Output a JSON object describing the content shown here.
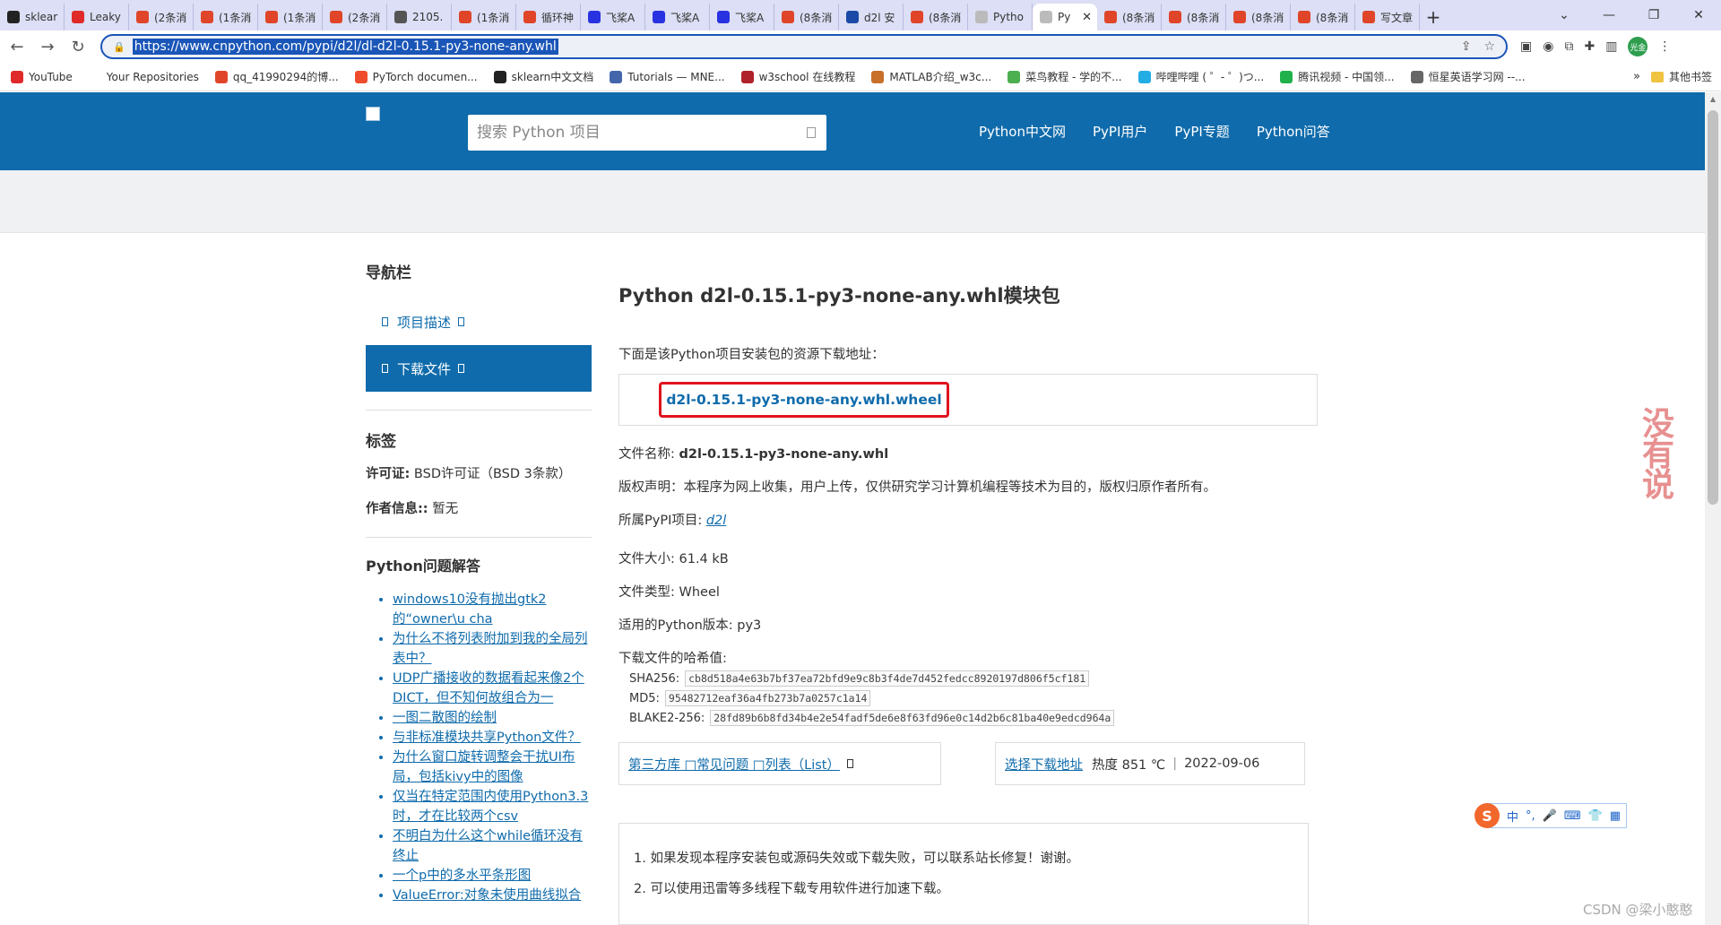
{
  "browser": {
    "tabs": [
      {
        "label": "sklear",
        "color": "#222"
      },
      {
        "label": "Leaky",
        "color": "#e02a2a"
      },
      {
        "label": "(2条消",
        "color": "#e0452a"
      },
      {
        "label": "(1条消",
        "color": "#e0452a"
      },
      {
        "label": "(1条消",
        "color": "#e0452a"
      },
      {
        "label": "(2条消",
        "color": "#e0452a"
      },
      {
        "label": "2105.",
        "color": "#555"
      },
      {
        "label": "(1条消",
        "color": "#e0452a"
      },
      {
        "label": "循环神",
        "color": "#e0452a"
      },
      {
        "label": "飞桨A",
        "color": "#2932e1"
      },
      {
        "label": "飞桨A",
        "color": "#2932e1"
      },
      {
        "label": "飞桨A",
        "color": "#2932e1"
      },
      {
        "label": "(8条消",
        "color": "#e0452a"
      },
      {
        "label": "d2l 安",
        "color": "#1a4aa8"
      },
      {
        "label": "(8条消",
        "color": "#e0452a"
      },
      {
        "label": "Pytho",
        "color": "#bbb"
      },
      {
        "label": "Py",
        "color": "#bbb",
        "active": true
      },
      {
        "label": "(8条消",
        "color": "#e0452a"
      },
      {
        "label": "(8条消",
        "color": "#e0452a"
      },
      {
        "label": "(8条消",
        "color": "#e0452a"
      },
      {
        "label": "(8条消",
        "color": "#e0452a"
      },
      {
        "label": "写文章",
        "color": "#e0452a"
      }
    ],
    "url": "https://www.cnpython.com/pypi/d2l/dl-d2l-0.15.1-py3-none-any.whl",
    "bookmarks": [
      {
        "label": "YouTube",
        "color": "#e02a2a"
      },
      {
        "label": "Your Repositories",
        "color": "#ffffff"
      },
      {
        "label": "qq_41990294的博...",
        "color": "#e0452a"
      },
      {
        "label": "PyTorch documen...",
        "color": "#ee4c2c"
      },
      {
        "label": "sklearn中文文档",
        "color": "#222"
      },
      {
        "label": "Tutorials — MNE...",
        "color": "#4466aa"
      },
      {
        "label": "w3school 在线教程",
        "color": "#b0222a"
      },
      {
        "label": "MATLAB介绍_w3c...",
        "color": "#c8702a"
      },
      {
        "label": "菜鸟教程 - 学的不...",
        "color": "#4caf50"
      },
      {
        "label": "哔哩哔哩 ( ゜- ゜)つ...",
        "color": "#23ade5"
      },
      {
        "label": "腾讯视频 - 中国领...",
        "color": "#20b14a"
      },
      {
        "label": "恒星英语学习网 --...",
        "color": "#666"
      }
    ],
    "bookmarks_more": "»",
    "other_bookmarks": "其他书签",
    "avatar_text": "光金"
  },
  "site": {
    "search_placeholder": "搜索 Python 项目",
    "nav": [
      "Python中文网",
      "PyPI用户",
      "PyPI专题",
      "Python问答"
    ]
  },
  "sidebar": {
    "nav_title": "导航栏",
    "nav_items": [
      {
        "label": "项目描述"
      },
      {
        "label": "下载文件",
        "active": true
      }
    ],
    "tags_title": "标签",
    "license_label": "许可证:",
    "license_value": "BSD许可证（BSD 3条款）",
    "author_label": "作者信息::",
    "author_value": "暂无",
    "qa_title": "Python问题解答",
    "qa_items": [
      "windows10没有抛出gtk2的“owner\\u cha",
      "为什么不将列表附加到我的全局列表中？",
      "UDP广播接收的数据看起来像2个DICT，但不知何故组合为一",
      "一图二散图的绘制",
      "与非标准模块共享Python文件？",
      "为什么窗口旋转调整会干扰UI布局，包括kivy中的图像",
      "仅当在特定范围内使用Python3.3时，才在比较两个csv",
      "不明白为什么这个while循环没有终止",
      "一个p中的多水平条形图",
      "ValueError:对象未使用曲线拟合"
    ]
  },
  "main": {
    "title": "Python d2l-0.15.1-py3-none-any.whl模块包",
    "intro": "下面是该Python项目安装包的资源下载地址：",
    "download_link": "d2l-0.15.1-py3-none-any.whl.wheel",
    "file_name_label": "文件名称:",
    "file_name": "d2l-0.15.1-py3-none-any.whl",
    "copyright": "版权声明：本程序为网上收集，用户上传，仅供研究学习计算机编程等技术为目的，版权归原作者所有。",
    "pypi_project_label": "所属PyPI项目:",
    "pypi_project": "d2l",
    "file_size_label": "文件大小:",
    "file_size": "61.4 kB",
    "file_type_label": "文件类型:",
    "file_type": "Wheel",
    "python_version_label": "适用的Python版本:",
    "python_version": "py3",
    "hash_title": "下载文件的哈希值:",
    "hashes": [
      {
        "name": "SHA256:",
        "value": "cb8d518a4e63b7bf37ea72bfd9e9c8b3f4de7d452fedcc8920197d806f5cf181"
      },
      {
        "name": "MD5:",
        "value": "95482712eaf36a4fb273b7a0257c1a14"
      },
      {
        "name": "BLAKE2-256:",
        "value": "28fd89b6b8fd34b4e2e54fadf5de6e8f63fd96e0c14d2b6c81ba40e9edcd964a"
      }
    ],
    "links_box": "第三方库 □常见问题 □列表（List）",
    "choose_download": "选择下载地址",
    "heat": "热度 851 ℃",
    "date": "2022-09-06",
    "notes": [
      "1. 如果发现本程序安装包或源码失效或下载失败，可以联系站长修复！谢谢。",
      "2. 可以使用迅雷等多线程下载专用软件进行加速下载。"
    ]
  },
  "overlays": {
    "stamp": "没有说",
    "ime": [
      "中",
      "°,",
      "🎤",
      "⌨",
      "👕",
      "▦"
    ],
    "ime_logo": "S",
    "watermark": "CSDN @梁小憨憨"
  }
}
